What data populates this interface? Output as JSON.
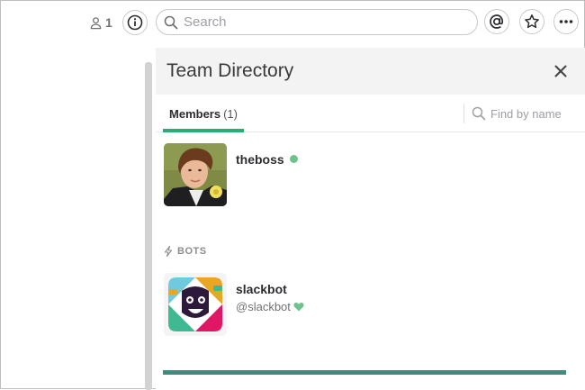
{
  "topbar": {
    "member_count": "1",
    "search_placeholder": "Search"
  },
  "pane": {
    "title": "Team Directory",
    "tab_label": "Members",
    "tab_count": "(1)",
    "find_placeholder": "Find by name"
  },
  "members": [
    {
      "name": "theboss",
      "status": "online"
    }
  ],
  "bots": {
    "section_label": "BOTS",
    "items": [
      {
        "name": "slackbot",
        "handle": "@slackbot"
      }
    ]
  },
  "colors": {
    "accent_green": "#2bac76",
    "presence_green": "#70c28d",
    "bottom_bar": "#3e8e7e"
  }
}
